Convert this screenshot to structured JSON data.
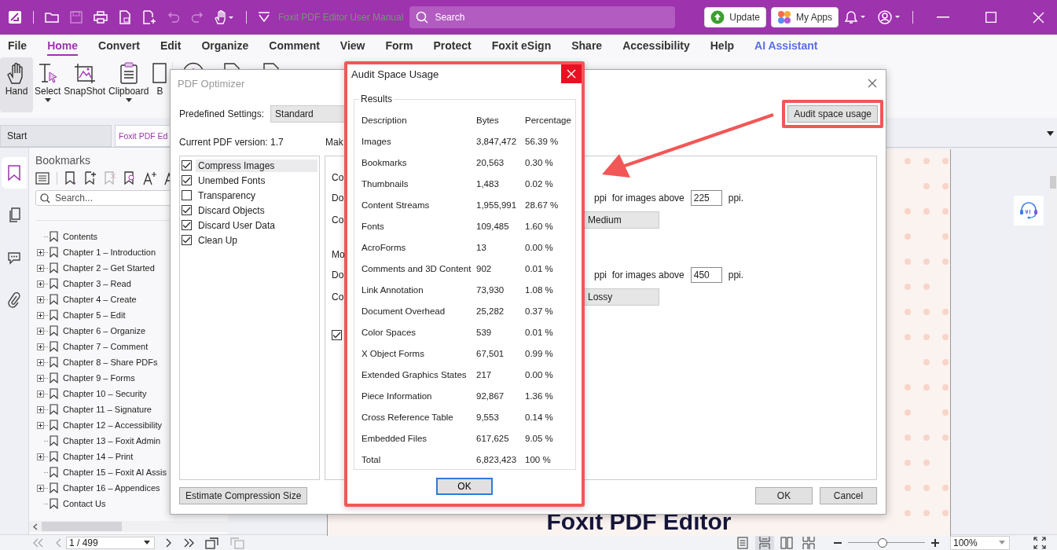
{
  "title_bar": {
    "document_title": "Foxit PDF Editor User Manual",
    "search": {
      "placeholder": "Search"
    },
    "buttons": [
      {
        "kind": "update",
        "label": "Update"
      },
      {
        "kind": "apps",
        "label": "My Apps"
      }
    ]
  },
  "menu": [
    {
      "label": "File",
      "selected": false,
      "kind": "tab"
    },
    {
      "label": "Home",
      "selected": true,
      "kind": "tab"
    },
    {
      "label": "Convert",
      "selected": false,
      "kind": "tab"
    },
    {
      "label": "Edit",
      "selected": false,
      "kind": "tab"
    },
    {
      "label": "Organize",
      "selected": false,
      "kind": "tab"
    },
    {
      "label": "Comment",
      "selected": false,
      "kind": "tab"
    },
    {
      "label": "View",
      "selected": false,
      "kind": "tab"
    },
    {
      "label": "Form",
      "selected": false,
      "kind": "tab"
    },
    {
      "label": "Protect",
      "selected": false,
      "kind": "tab"
    },
    {
      "label": "Foxit eSign",
      "selected": false,
      "kind": "tab"
    },
    {
      "label": "Share",
      "selected": false,
      "kind": "tab"
    },
    {
      "label": "Accessibility",
      "selected": false,
      "kind": "tab"
    },
    {
      "label": "Help",
      "selected": false,
      "kind": "tab"
    },
    {
      "label": "AI Assistant",
      "selected": false,
      "kind": "assistant"
    }
  ],
  "ribbon": [
    {
      "label": "Hand",
      "selected": true,
      "kind": "hand",
      "dropdown": false
    },
    {
      "label": "Select",
      "selected": false,
      "kind": "select",
      "dropdown": true
    },
    {
      "label": "SnapShot",
      "selected": false,
      "kind": "snapshot",
      "dropdown": false
    },
    {
      "label": "Clipboard",
      "selected": false,
      "kind": "clipboard",
      "dropdown": true
    },
    {
      "label": "B",
      "selected": false,
      "kind": "document",
      "dropdown": false
    }
  ],
  "doc_tabs": [
    {
      "label": "Start",
      "selected": false
    },
    {
      "label": "Foxit PDF Ed",
      "selected": true
    }
  ],
  "side_rail": [
    {
      "kind": "bookmarks",
      "selected": true
    },
    {
      "kind": "pages",
      "selected": false
    },
    {
      "kind": "comments",
      "selected": false
    },
    {
      "kind": "attachments",
      "selected": false
    }
  ],
  "bookmarks": {
    "title": "Bookmarks",
    "search": {
      "placeholder": "Search..."
    },
    "items": [
      {
        "label": "Contents",
        "expandable": false
      },
      {
        "label": "Chapter 1 – Introduction",
        "expandable": true
      },
      {
        "label": "Chapter 2 – Get Started",
        "expandable": true
      },
      {
        "label": "Chapter 3 – Read",
        "expandable": true
      },
      {
        "label": "Chapter 4 – Create",
        "expandable": true
      },
      {
        "label": "Chapter 5 – Edit",
        "expandable": true
      },
      {
        "label": "Chapter 6 – Organize",
        "expandable": true
      },
      {
        "label": "Chapter 7 – Comment",
        "expandable": true
      },
      {
        "label": "Chapter 8 – Share PDFs",
        "expandable": true
      },
      {
        "label": "Chapter 9 – Forms",
        "expandable": true
      },
      {
        "label": "Chapter 10 – Security",
        "expandable": true
      },
      {
        "label": "Chapter 11 – Signature",
        "expandable": true
      },
      {
        "label": "Chapter 12 – Accessibility",
        "expandable": true
      },
      {
        "label": "Chapter 13 – Foxit Admin",
        "expandable": false
      },
      {
        "label": "Chapter 14 – Print",
        "expandable": true
      },
      {
        "label": "Chapter 15 – Foxit AI Assis",
        "expandable": false
      },
      {
        "label": "Chapter 16 – Appendices",
        "expandable": true
      },
      {
        "label": "Contact Us",
        "expandable": false
      }
    ]
  },
  "document": {
    "heading": "Foxit PDF Editor"
  },
  "pdf_optimizer": {
    "title": "PDF Optimizer",
    "predefined_label": "Predefined Settings:",
    "predefined_value": "Standard",
    "audit_button": "Audit space usage",
    "version": "Current PDF version: 1.7",
    "make_label": "Mak",
    "options": [
      {
        "label": "Compress Images",
        "checked": true,
        "selected": true
      },
      {
        "label": "Unembed Fonts",
        "checked": true,
        "selected": false
      },
      {
        "label": "Transparency",
        "checked": false,
        "selected": false
      },
      {
        "label": "Discard Objects",
        "checked": true,
        "selected": false
      },
      {
        "label": "Discard User Data",
        "checked": true,
        "selected": false
      },
      {
        "label": "Clean Up",
        "checked": true,
        "selected": false
      }
    ],
    "settings": [
      {
        "kind": "heading",
        "label": "Co"
      },
      {
        "kind": "ppi",
        "label": "Do",
        "text": "ppi  for images above",
        "value": "225",
        "unit": "ppi."
      },
      {
        "kind": "select",
        "label": "Co",
        "value": "Medium"
      },
      {
        "kind": "heading",
        "label": "Mo"
      },
      {
        "kind": "ppi",
        "label": "Do",
        "text": "ppi  for images above",
        "value": "450",
        "unit": "ppi."
      },
      {
        "kind": "select",
        "label": "Co",
        "value": "Lossy"
      },
      {
        "kind": "check",
        "checked": true
      }
    ],
    "estimate_button": "Estimate Compression Size",
    "buttons": [
      "OK",
      "Cancel"
    ]
  },
  "audit_dialog": {
    "title": "Audit Space Usage",
    "group": "Results",
    "columns": [
      "Description",
      "Bytes",
      "Percentage"
    ],
    "rows": [
      [
        "Images",
        "3,847,472",
        "56.39 %"
      ],
      [
        "Bookmarks",
        "20,563",
        "0.30 %"
      ],
      [
        "Thumbnails",
        "1,483",
        "0.02 %"
      ],
      [
        "Content Streams",
        "1,955,991",
        "28.67 %"
      ],
      [
        "Fonts",
        "109,485",
        "1.60 %"
      ],
      [
        "AcroForms",
        "13",
        "0.00 %"
      ],
      [
        "Comments and 3D Content",
        "902",
        "0.01 %"
      ],
      [
        "Link Annotation",
        "73,930",
        "1.08 %"
      ],
      [
        "Document Overhead",
        "25,282",
        "0.37 %"
      ],
      [
        "Color Spaces",
        "539",
        "0.01 %"
      ],
      [
        "X Object Forms",
        "67,501",
        "0.99 %"
      ],
      [
        "Extended Graphics States",
        "217",
        "0.00 %"
      ],
      [
        "Piece Information",
        "92,867",
        "1.36 %"
      ],
      [
        "Cross Reference Table",
        "9,553",
        "0.14 %"
      ],
      [
        "Embedded Files",
        "617,625",
        "9.05 %"
      ],
      [
        "Total",
        "6,823,423",
        "100 %"
      ]
    ],
    "ok_button": "OK"
  },
  "status_bar": {
    "page": "1 / 499",
    "view_modes": [
      {
        "kind": "single",
        "selected": false
      },
      {
        "kind": "continuous",
        "selected": true
      },
      {
        "kind": "facing",
        "selected": false
      },
      {
        "kind": "continuous_facing",
        "selected": false
      }
    ],
    "zoom_slider": {
      "level": 0.45
    },
    "zoom": "100%"
  }
}
